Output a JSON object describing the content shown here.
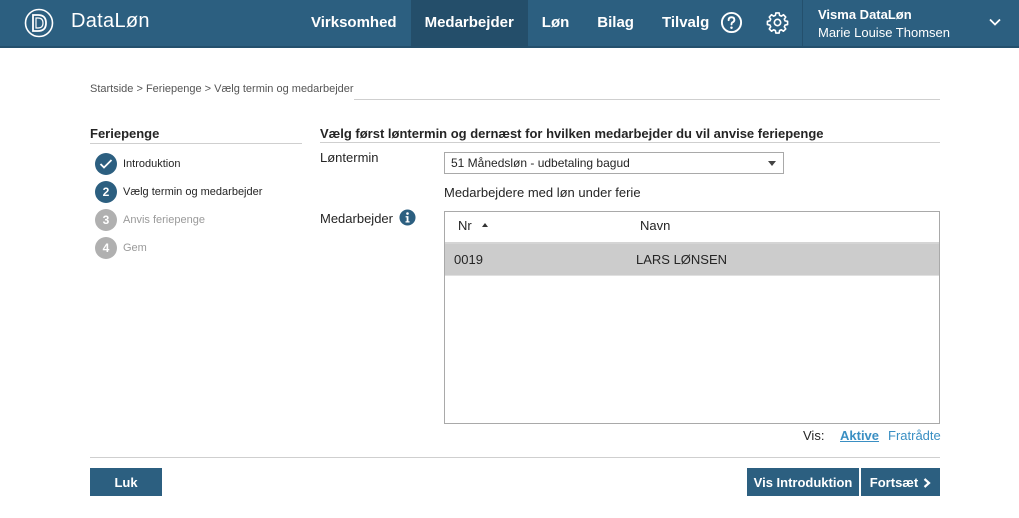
{
  "app": {
    "brand": "DataLøn"
  },
  "nav": {
    "items": [
      {
        "label": "Virksomhed",
        "active": false
      },
      {
        "label": "Medarbejder",
        "active": true
      },
      {
        "label": "Løn",
        "active": false
      },
      {
        "label": "Bilag",
        "active": false
      },
      {
        "label": "Tilvalg",
        "active": false
      }
    ]
  },
  "user": {
    "company": "Visma DataLøn",
    "name": "Marie Louise Thomsen"
  },
  "breadcrumb": "Startside > Feriepenge > Vælg termin og medarbejder",
  "steps": {
    "title": "Feriepenge",
    "items": [
      {
        "number": "✓",
        "label": "Introduktion",
        "state": "done"
      },
      {
        "number": "2",
        "label": "Vælg termin og medarbejder",
        "state": "current"
      },
      {
        "number": "3",
        "label": "Anvis feriepenge",
        "state": "todo"
      },
      {
        "number": "4",
        "label": "Gem",
        "state": "todo"
      }
    ]
  },
  "main": {
    "title": "Vælg først løntermin og dernæst for hvilken medarbejder du vil anvise feriepenge",
    "term_label": "Løntermin",
    "term_value": "51 Månedsløn - udbetaling bagud",
    "employee_label": "Medarbejder",
    "list_caption": "Medarbejdere med løn under ferie"
  },
  "table": {
    "columns": [
      "Nr",
      "Navn"
    ],
    "rows": [
      {
        "nr": "0019",
        "name": "LARS LØNSEN"
      }
    ]
  },
  "filter": {
    "label": "Vis:",
    "active": "Aktive",
    "retired": "Fratrådte"
  },
  "buttons": {
    "close": "Luk",
    "intro": "Vis Introduktion",
    "continue": "Fortsæt"
  },
  "colors": {
    "header": "#2c5f80",
    "link": "#3a8fc3",
    "selected_row": "#cccccc"
  }
}
